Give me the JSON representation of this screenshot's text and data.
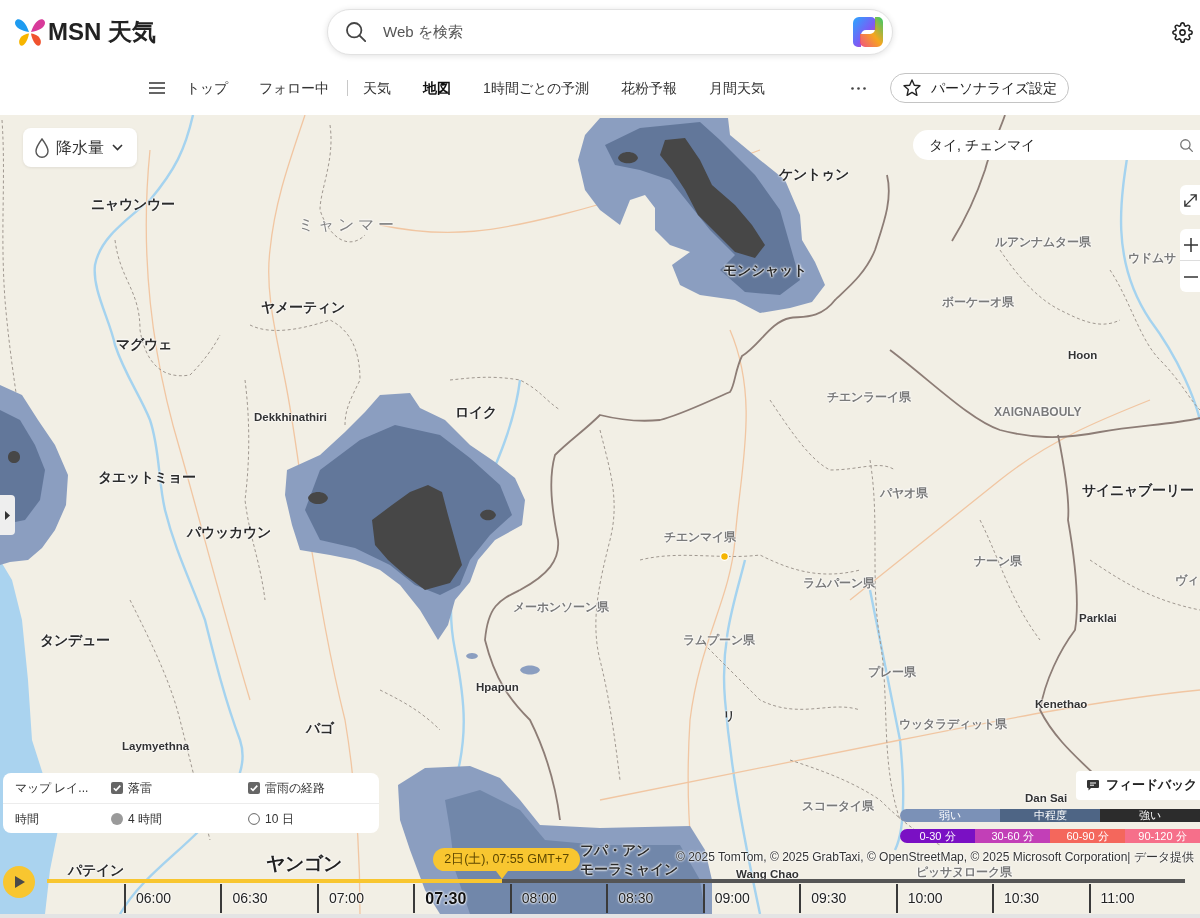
{
  "header": {
    "logo": "MSN 天気",
    "search": {
      "placeholder": "Web を検索"
    }
  },
  "nav": {
    "pinned": [
      {
        "label": "トップ",
        "selected": false
      },
      {
        "label": "フォロー中",
        "selected": false
      }
    ],
    "items": [
      {
        "label": "天気",
        "selected": false
      },
      {
        "label": "地図",
        "selected": true
      },
      {
        "label": "1時間ごとの予測",
        "selected": false
      },
      {
        "label": "花粉予報",
        "selected": false
      },
      {
        "label": "月間天気",
        "selected": false
      }
    ],
    "personalize_button": "パーソナライズ設定"
  },
  "map": {
    "layer_dropdown": {
      "label": "降水量"
    },
    "location_search": {
      "value": "タイ, チェンマイ"
    },
    "labels": [
      {
        "text": "ニャウンウー",
        "kind": "city"
      },
      {
        "text": "ミャンマー",
        "kind": "country"
      },
      {
        "text": "ヤメーティン",
        "kind": "city"
      },
      {
        "text": "マグウェ",
        "kind": "city"
      },
      {
        "text": "Dekkhinathiri",
        "kind": "town"
      },
      {
        "text": "ロイク",
        "kind": "city"
      },
      {
        "text": "タエットミョー",
        "kind": "city"
      },
      {
        "text": "パウッカウン",
        "kind": "city"
      },
      {
        "text": "タンデュー",
        "kind": "city"
      },
      {
        "text": "Hpapun",
        "kind": "town"
      },
      {
        "text": "バゴ",
        "kind": "city"
      },
      {
        "text": "Laymyethna",
        "kind": "town"
      },
      {
        "text": "パテイン",
        "kind": "city"
      },
      {
        "text": "ヤンゴン",
        "kind": "capital"
      },
      {
        "text": "フパ・アン",
        "kind": "city"
      },
      {
        "text": "モーラミャイン",
        "kind": "city"
      },
      {
        "text": "ケントゥン",
        "kind": "city"
      },
      {
        "text": "モンシャット",
        "kind": "city"
      },
      {
        "text": "ルアンナムター県",
        "kind": "province"
      },
      {
        "text": "ウドムサ",
        "kind": "province"
      },
      {
        "text": "ボーケーオ県",
        "kind": "province"
      },
      {
        "text": "Hoon",
        "kind": "town"
      },
      {
        "text": "チエンラーイ県",
        "kind": "province"
      },
      {
        "text": "XAIGNABOULY",
        "kind": "province"
      },
      {
        "text": "パヤオ県",
        "kind": "province"
      },
      {
        "text": "サイニャブーリー",
        "kind": "city"
      },
      {
        "text": "チエンマイ県",
        "kind": "province"
      },
      {
        "text": "ナーン県",
        "kind": "province"
      },
      {
        "text": "ヴィ",
        "kind": "province"
      },
      {
        "text": "ラムパーン県",
        "kind": "province"
      },
      {
        "text": "メーホンソーン県",
        "kind": "province"
      },
      {
        "text": "Parklai",
        "kind": "town"
      },
      {
        "text": "ラムプーン県",
        "kind": "province"
      },
      {
        "text": "プレー県",
        "kind": "province"
      },
      {
        "text": "リ",
        "kind": "town"
      },
      {
        "text": "ウッタラディット県",
        "kind": "province"
      },
      {
        "text": "Kenethao",
        "kind": "town"
      },
      {
        "text": "Dan Sai",
        "kind": "town"
      },
      {
        "text": "スコータイ県",
        "kind": "province"
      },
      {
        "text": "Wang Chao",
        "kind": "town"
      },
      {
        "text": "ピッサヌローク県",
        "kind": "province"
      }
    ],
    "layers_panel": {
      "rows": [
        {
          "label": "マップ レイ...",
          "options": [
            {
              "kind": "checkbox",
              "label": "落雷",
              "checked": true
            },
            {
              "kind": "checkbox",
              "label": "雷雨の経路",
              "checked": true
            }
          ]
        },
        {
          "label": "時間",
          "options": [
            {
              "kind": "radio",
              "label": "4 時間",
              "selected": true
            },
            {
              "kind": "radio",
              "label": "10 日",
              "selected": false
            }
          ]
        }
      ]
    },
    "feedback_button": "フィードバック",
    "legend": {
      "intensity": [
        {
          "label": "弱い",
          "color": "#7b91b7"
        },
        {
          "label": "中程度",
          "color": "#4e6585"
        },
        {
          "label": "強い",
          "color": "#2c2c2c"
        }
      ],
      "duration": [
        {
          "label": "0-30 分",
          "color": "#7a10c4"
        },
        {
          "label": "30-60 分",
          "color": "#c23fb7"
        },
        {
          "label": "60-90 分",
          "color": "#f4675c"
        },
        {
          "label": "90-120 分",
          "color": "#f66f8a"
        }
      ]
    },
    "attribution": "© 2025 TomTom, © 2025 GrabTaxi, © OpenStreetMap, © 2025 Microsoft Corporation| データ提供"
  },
  "timeline": {
    "tooltip": "2日(土), 07:55 GMT+7",
    "level": 0.4,
    "slots": [
      {
        "label": "06:00",
        "selected": false
      },
      {
        "label": "06:30",
        "selected": false
      },
      {
        "label": "07:00",
        "selected": false
      },
      {
        "label": "07:30",
        "selected": true
      },
      {
        "label": "08:00",
        "selected": false
      },
      {
        "label": "08:30",
        "selected": false
      },
      {
        "label": "09:00",
        "selected": false
      },
      {
        "label": "09:30",
        "selected": false
      },
      {
        "label": "10:00",
        "selected": false
      },
      {
        "label": "10:30",
        "selected": false
      },
      {
        "label": "11:00",
        "selected": false
      }
    ]
  }
}
